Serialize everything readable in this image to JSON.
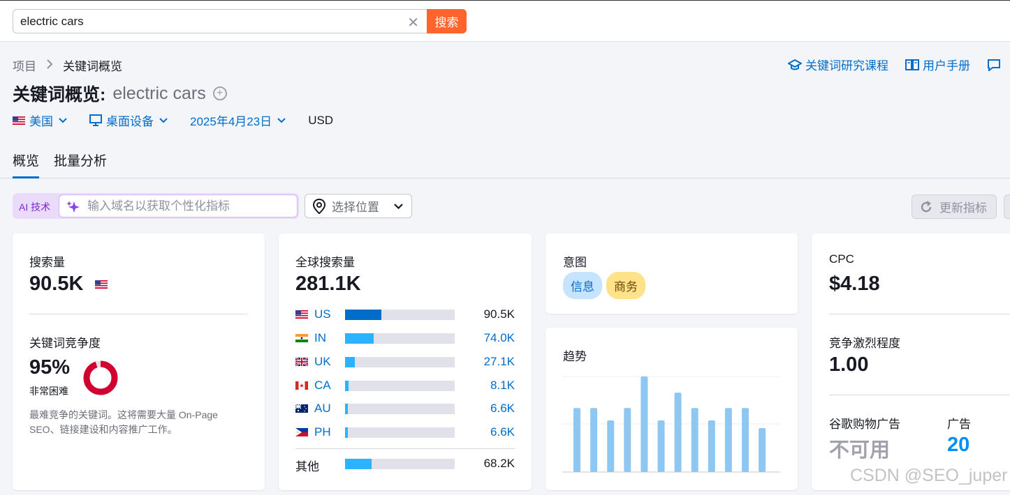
{
  "search": {
    "value": "electric cars",
    "button": "搜索"
  },
  "breadcrumb": {
    "root": "项目",
    "current": "关键词概览"
  },
  "header_links": {
    "course": "关键词研究课程",
    "manual": "用户手册"
  },
  "title": {
    "main": "关键词概览:",
    "keyword": "electric cars"
  },
  "filters": {
    "country": "美国",
    "device": "桌面设备",
    "date": "2025年4月23日",
    "currency": "USD"
  },
  "tabs": [
    "概览",
    "批量分析"
  ],
  "ai": {
    "label": "AI 技术",
    "placeholder": "输入域名以获取个性化指标"
  },
  "location": {
    "placeholder": "选择位置"
  },
  "refresh": {
    "label": "更新指标"
  },
  "volume": {
    "label": "搜索量",
    "value": "90.5K"
  },
  "kd": {
    "label": "关键词竞争度",
    "percent": "95%",
    "level": "非常困难",
    "description": "最难竞争的关键词。这将需要大量 On-Page SEO、链接建设和内容推广工作。",
    "fraction": 0.95,
    "color": "#d1002f"
  },
  "global": {
    "label": "全球搜索量",
    "value": "281.1K",
    "countries": [
      {
        "code": "US",
        "value": "90.5K",
        "share": 0.33
      },
      {
        "code": "IN",
        "value": "74.0K",
        "share": 0.26
      },
      {
        "code": "UK",
        "value": "27.1K",
        "share": 0.09
      },
      {
        "code": "CA",
        "value": "8.1K",
        "share": 0.03
      },
      {
        "code": "AU",
        "value": "6.6K",
        "share": 0.025
      },
      {
        "code": "PH",
        "value": "6.6K",
        "share": 0.025
      }
    ],
    "other": {
      "label": "其他",
      "value": "68.2K",
      "share": 0.24
    }
  },
  "intent": {
    "label": "意图",
    "badges": [
      "信息",
      "商务"
    ]
  },
  "trend": {
    "label": "趋势",
    "values": [
      0.67,
      0.67,
      0.54,
      0.67,
      1.0,
      0.54,
      0.83,
      0.67,
      0.54,
      0.67,
      0.67,
      0.46
    ]
  },
  "cpc": {
    "label": "CPC",
    "value": "$4.18"
  },
  "competition": {
    "label": "竞争激烈程度",
    "value": "1.00"
  },
  "shopping": {
    "label": "谷歌购物广告",
    "value": "不可用"
  },
  "ads": {
    "label": "广告",
    "value": "20"
  },
  "watermark": "CSDN @SEO_juper",
  "colors": {
    "primary": "#006dca",
    "search_button": "#ff642d",
    "bar_primary": "#006dca",
    "bar_secondary": "#2bb3ff",
    "trend_bar": "#8ec8f2"
  }
}
